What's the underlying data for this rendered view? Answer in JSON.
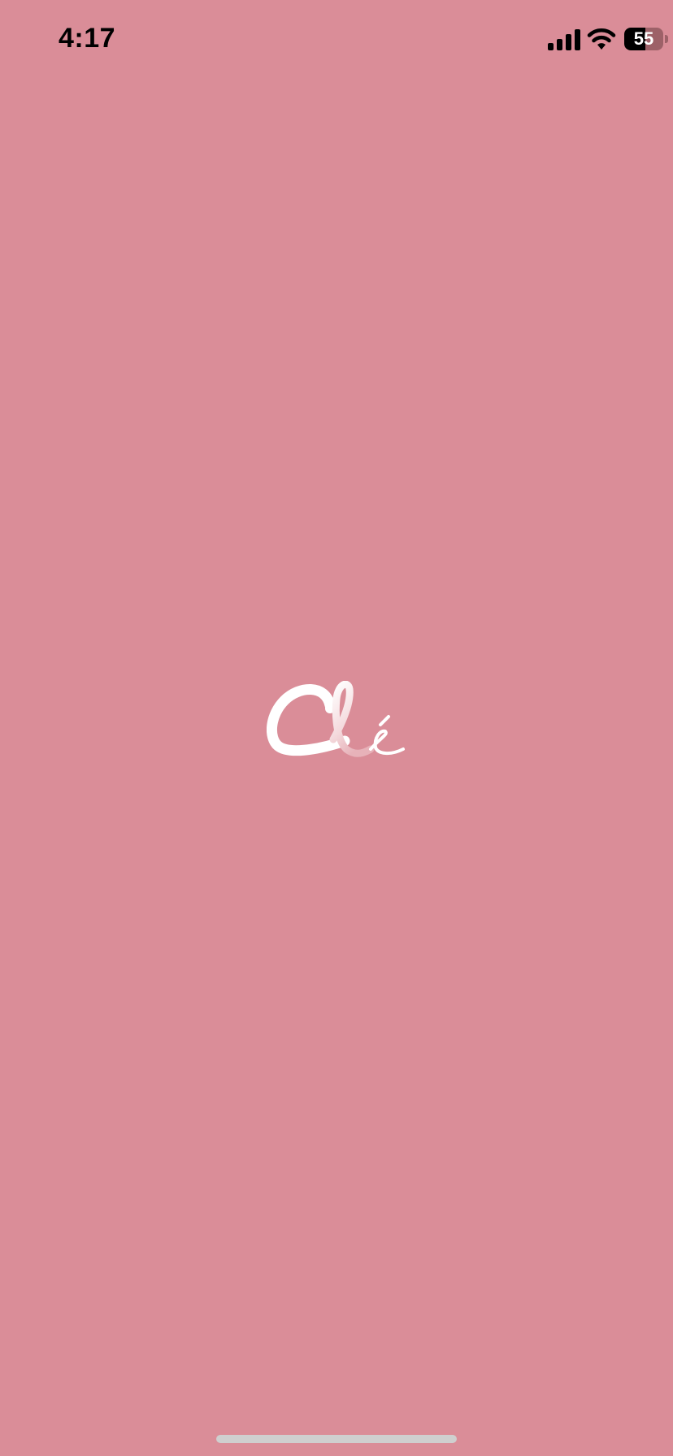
{
  "status_bar": {
    "time": "4:17",
    "battery_text": "55",
    "battery_level": 0.55,
    "icons": [
      "cellular-signal-icon",
      "wifi-icon",
      "battery-icon"
    ]
  },
  "app": {
    "logo_text": "Clé",
    "background_color": "#DA8D98",
    "logo_color": "#FFFFFF"
  }
}
